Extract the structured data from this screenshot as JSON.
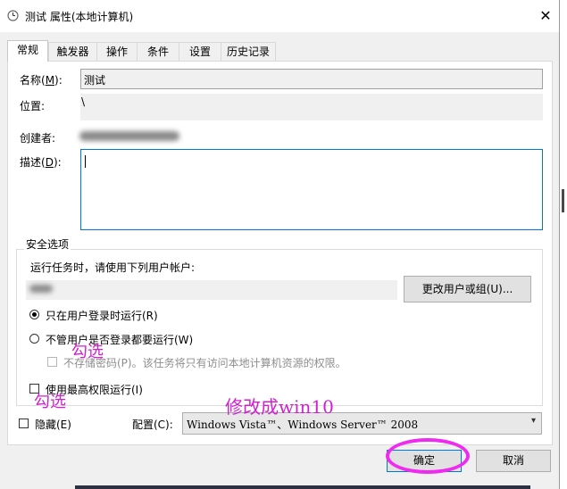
{
  "window": {
    "title": "测试 属性(本地计算机)",
    "close_glyph": "✕"
  },
  "tabs": [
    {
      "label": "常规"
    },
    {
      "label": "触发器"
    },
    {
      "label": "操作"
    },
    {
      "label": "条件"
    },
    {
      "label": "设置"
    },
    {
      "label": "历史记录"
    }
  ],
  "general": {
    "name_label": "名称(",
    "name_key": "M",
    "name_label_end": "):",
    "name_value": "测试",
    "location_label": "位置:",
    "location_value": "\\",
    "author_label": "创建者:",
    "description_label": "描述(",
    "description_key": "D",
    "description_label_end": "):"
  },
  "security": {
    "title": "安全选项",
    "run_as_prompt": "运行任务时，请使用下列用户帐户:",
    "change_user_button": "更改用户或组(U)...",
    "option_logged_on": "只在用户登录时运行(R)",
    "option_whether_logged": "不管用户是否登录都要运行(W)",
    "option_no_store_password": "不存储密码(P)。该任务将只有访问本地计算机资源的权限。",
    "option_highest_privileges": "使用最高权限运行(I)"
  },
  "bottom": {
    "hidden_label": "隐藏(E)",
    "configure_label": "配置(C):",
    "configure_value": "Windows Vista™、Windows Server™ 2008"
  },
  "buttons": {
    "ok": "确定",
    "cancel": "取消"
  },
  "annotations": {
    "check_note_1": "勾选",
    "check_note_2": "勾选",
    "change_note": "修改成win10"
  }
}
